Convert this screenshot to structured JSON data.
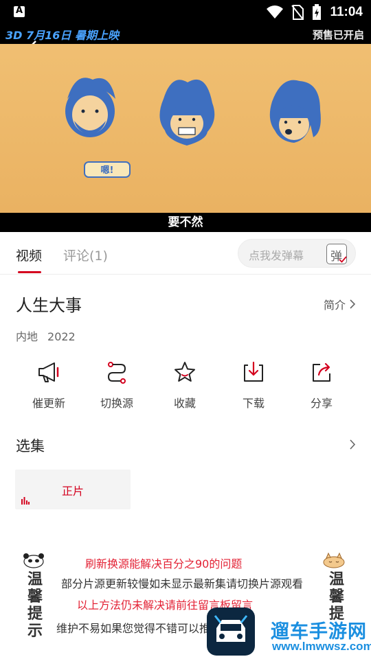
{
  "status_bar": {
    "time": "11:04"
  },
  "video": {
    "promo_left": "3D 7月16日 暑期上映",
    "promo_right": "预售已开启",
    "speech_bubble": "嗯!",
    "subtitle": "要不然"
  },
  "tabs": [
    {
      "label": "视频",
      "active": true
    },
    {
      "label": "评论(1)",
      "active": false
    }
  ],
  "danmaku": {
    "placeholder": "点我发弹幕",
    "icon_label": "弹"
  },
  "show": {
    "title": "人生大事",
    "intro_label": "简介",
    "region": "内地",
    "year": "2022"
  },
  "actions": [
    {
      "label": "催更新",
      "icon": "megaphone-icon"
    },
    {
      "label": "切换源",
      "icon": "switch-source-icon"
    },
    {
      "label": "收藏",
      "icon": "star-icon"
    },
    {
      "label": "下载",
      "icon": "download-icon"
    },
    {
      "label": "分享",
      "icon": "share-icon"
    }
  ],
  "episodes": {
    "title": "选集",
    "items": [
      {
        "label": "正片",
        "playing": true
      }
    ]
  },
  "notice": {
    "side_left": "温馨提示",
    "side_right": "温馨提",
    "lines": [
      "刷新换源能解决百分之90的问题",
      "部分片源更新较慢如未显示最新集请切换片源观看",
      "以上方法仍未解决请前往留言板留言",
      "维护不易如果您觉得不错可以推荐给您的"
    ]
  },
  "watermark": {
    "text": "遛车手游网",
    "url": "www.lmwwsz.com"
  },
  "colors": {
    "accent": "#d4001e",
    "video_bg": "#efb86a",
    "character_blue": "#3e6fc0",
    "watermark_blue": "#1b8fe0"
  }
}
